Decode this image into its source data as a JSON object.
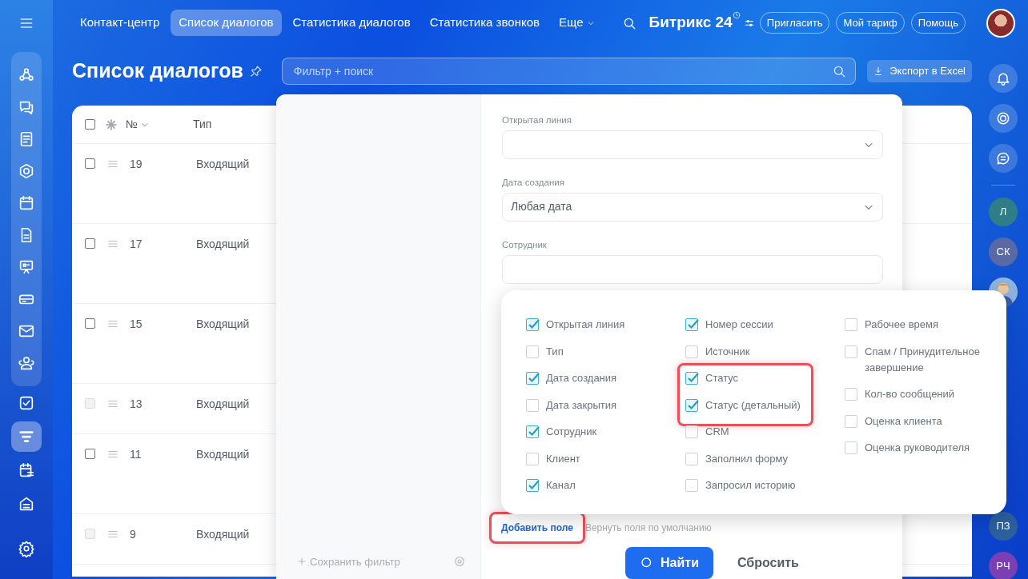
{
  "left_sidebar": {
    "items": [
      {
        "selected": false
      },
      {
        "selected": false
      },
      {
        "selected": false
      },
      {
        "selected": false
      },
      {
        "selected": false
      },
      {
        "selected": false
      },
      {
        "selected": false
      },
      {
        "selected": false
      },
      {
        "selected": false
      },
      {
        "selected": false
      },
      {
        "selected": false
      },
      {
        "selected": true
      },
      {
        "selected": false
      },
      {
        "selected": false
      }
    ]
  },
  "top_nav": {
    "tabs": [
      {
        "label": "Контакт-центр",
        "selected": false
      },
      {
        "label": "Список диалогов",
        "selected": true
      },
      {
        "label": "Статистика диалогов",
        "selected": false
      },
      {
        "label": "Статистика звонков",
        "selected": false
      }
    ],
    "more": "Еще",
    "logo": {
      "name": "Битрикс",
      "number": "24"
    },
    "buttons": [
      "Пригласить",
      "Мой тариф",
      "Помощь"
    ]
  },
  "page": {
    "title": "Список диалогов",
    "search": {
      "placeholder": "Фильтр + поиск"
    },
    "export_button": "Экспорт в Excel"
  },
  "table": {
    "all_selected": false,
    "columns": [
      "№",
      "Тип"
    ],
    "rows": [
      {
        "number": "19",
        "type": "Входящий",
        "disabled": false,
        "tall": true
      },
      {
        "number": "17",
        "type": "Входящий",
        "disabled": false,
        "tall": true
      },
      {
        "number": "15",
        "type": "Входящий",
        "disabled": false,
        "tall": true
      },
      {
        "number": "13",
        "type": "Входящий",
        "disabled": true,
        "tall": false
      },
      {
        "number": "11",
        "type": "Входящий",
        "disabled": false,
        "tall": true
      },
      {
        "number": "9",
        "type": "Входящий",
        "disabled": true,
        "tall": false
      }
    ]
  },
  "right_sidebar": {
    "avatars": [
      {
        "kind": "initials",
        "initials": "Л",
        "color": "#2e7d88"
      },
      {
        "kind": "initials",
        "initials": "СК",
        "color": "#5869a6"
      },
      {
        "kind": "picture"
      }
    ],
    "bottom_avatars": [
      {
        "kind": "initials",
        "initials": "ПЗ",
        "color": "#2c5f9e"
      },
      {
        "kind": "initials",
        "initials": "РЧ",
        "color": "#7a3fb5"
      }
    ]
  },
  "filter": {
    "save_filter": "Сохранить фильтр",
    "fields": [
      {
        "label": "Открытая линия",
        "kind": "select"
      },
      {
        "label": "Дата создания",
        "kind": "select",
        "value": "Любая дата"
      },
      {
        "label": "Сотрудник",
        "kind": "input"
      }
    ],
    "add_field": {
      "label": "Добавить поле",
      "highlighted": true
    },
    "restore_fields": "Вернуть поля по умолчанию",
    "find_button": "Найти",
    "reset_button": "Сбросить"
  },
  "field_picker": {
    "columns": [
      [
        {
          "kind": "field",
          "label": "Открытая линия",
          "checked": true
        },
        {
          "kind": "field",
          "label": "Тип",
          "checked": false
        },
        {
          "kind": "field",
          "label": "Дата создания",
          "checked": true
        },
        {
          "kind": "field",
          "label": "Дата закрытия",
          "checked": false
        },
        {
          "kind": "field",
          "label": "Сотрудник",
          "checked": true
        },
        {
          "kind": "field",
          "label": "Клиент",
          "checked": false
        },
        {
          "kind": "field",
          "label": "Канал",
          "checked": true
        }
      ],
      [
        {
          "kind": "field",
          "label": "Номер сессии",
          "checked": true
        },
        {
          "kind": "field",
          "label": "Источник",
          "checked": false
        },
        {
          "kind": "highlight-group",
          "items": [
            {
              "kind": "field",
              "label": "Статус",
              "checked": true
            },
            {
              "kind": "field",
              "label": "Статус (детальный)",
              "checked": true
            }
          ]
        },
        {
          "kind": "field",
          "label": "CRM",
          "checked": false
        },
        {
          "kind": "field",
          "label": "Заполнил форму",
          "checked": false
        },
        {
          "kind": "field",
          "label": "Запросил историю",
          "checked": false
        }
      ],
      [
        {
          "kind": "field",
          "label": "Рабочее время",
          "checked": false
        },
        {
          "kind": "field",
          "label": "Спам / Принудительное завершение",
          "checked": false
        },
        {
          "kind": "field",
          "label": "Кол-во сообщений",
          "checked": false
        },
        {
          "kind": "field",
          "label": "Оценка клиента",
          "checked": false
        },
        {
          "kind": "field",
          "label": "Оценка руководителя",
          "checked": false
        }
      ]
    ]
  }
}
